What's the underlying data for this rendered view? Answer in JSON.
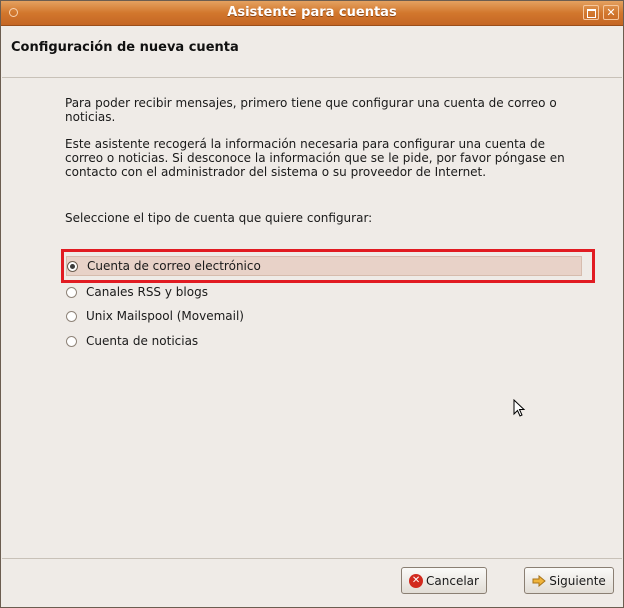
{
  "window": {
    "title": "Asistente para cuentas",
    "page_title": "Configuración de nueva cuenta"
  },
  "intro": {
    "para1": "Para poder recibir mensajes, primero tiene que configurar una cuenta de correo o noticias.",
    "para2": "Este asistente recogerá la información necesaria para configurar una cuenta de correo o noticias. Si desconoce la información que se le pide, por favor póngase en contacto con el administrador del sistema o su proveedor de Internet.",
    "prompt": "Seleccione el tipo de cuenta que quiere configurar:"
  },
  "account_types": [
    {
      "label": "Cuenta de correo electrónico",
      "selected": true
    },
    {
      "label": "Canales RSS y blogs",
      "selected": false
    },
    {
      "label": "Unix Mailspool (Movemail)",
      "selected": false
    },
    {
      "label": "Cuenta de noticias",
      "selected": false
    }
  ],
  "buttons": {
    "cancel": "Cancelar",
    "next": "Siguiente"
  },
  "icons": {
    "cancel": "cancel-icon",
    "next": "arrow-right-icon",
    "window_menu": "window-menu-icon",
    "maximize": "maximize-icon",
    "close": "close-icon",
    "cursor": "mouse-cursor-icon"
  },
  "colors": {
    "titlebar": "#d2772d",
    "background": "#efebe7",
    "highlight": "#e11b22",
    "selected_row": "#e8d2c8"
  }
}
